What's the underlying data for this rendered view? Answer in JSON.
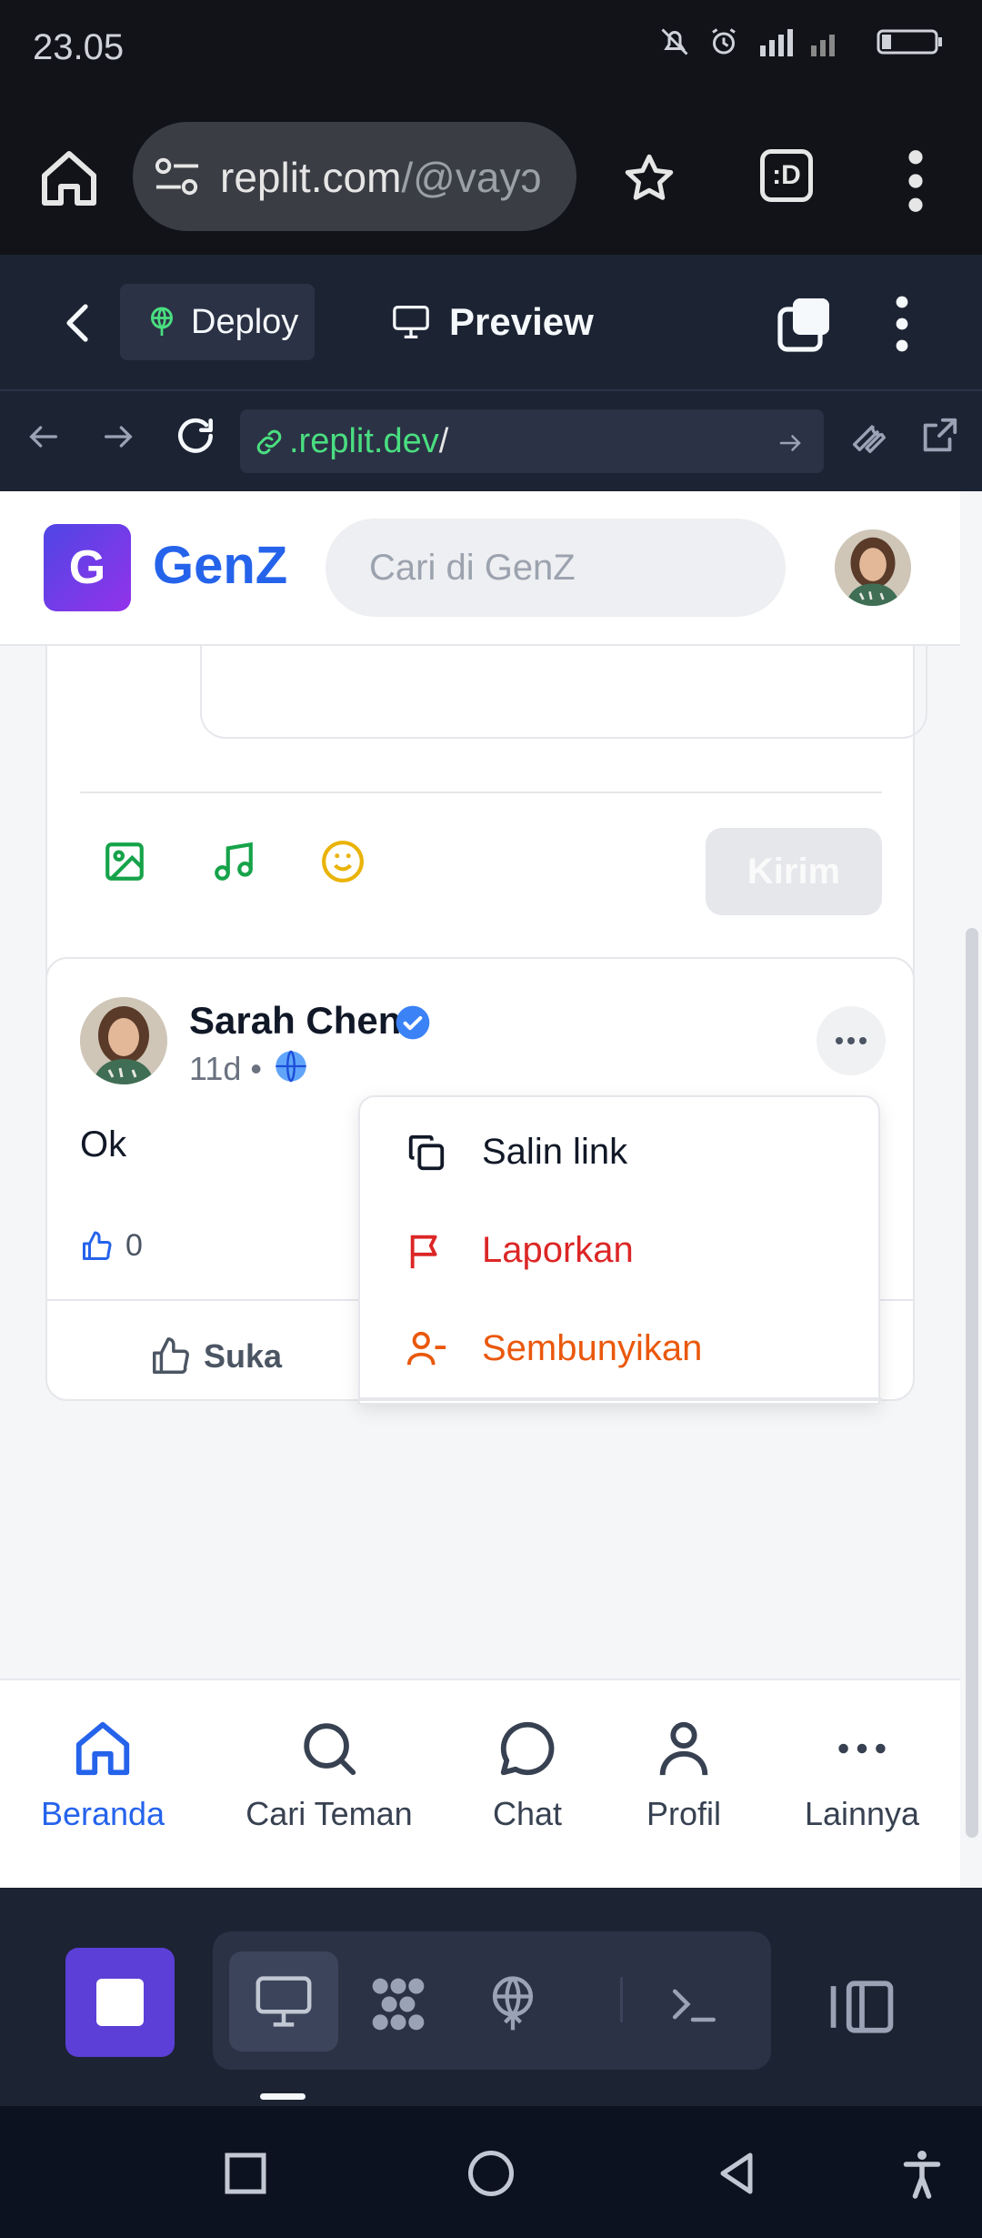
{
  "status_bar": {
    "time": "23.05"
  },
  "browser": {
    "url_host": "replit.com",
    "url_path": "/@vayɔ",
    "tabs_label": ":D"
  },
  "replit": {
    "deploy_label": "Deploy",
    "preview_label": "Preview",
    "address": ".replit.dev",
    "address_slash": "/"
  },
  "app": {
    "logo_letter": "G",
    "brand": "GenZ",
    "search_placeholder": "Cari di GenZ",
    "composer": {
      "submit_label": "Kirim"
    },
    "post": {
      "author": "Sarah Chen",
      "time": "11d •",
      "text": "Ok",
      "like_count": "0",
      "like_label": "Suka"
    },
    "menu": {
      "items": [
        {
          "label": "Salin link",
          "color": "#111827"
        },
        {
          "label": "Laporkan",
          "color": "#dc2626"
        },
        {
          "label": "Sembunyikan",
          "color": "#ea580c"
        }
      ]
    },
    "bottom_nav": [
      {
        "label": "Beranda",
        "icon": "home-icon",
        "active": true
      },
      {
        "label": "Cari Teman",
        "icon": "search-icon"
      },
      {
        "label": "Chat",
        "icon": "chat-icon"
      },
      {
        "label": "Profil",
        "icon": "user-icon"
      },
      {
        "label": "Lainnya",
        "icon": "more-icon"
      }
    ]
  },
  "colors": {
    "brand": "#2563eb",
    "replit_bg": "#1c2333",
    "stop_button": "#5b3fd6",
    "danger": "#dc2626",
    "warning": "#ea580c"
  }
}
